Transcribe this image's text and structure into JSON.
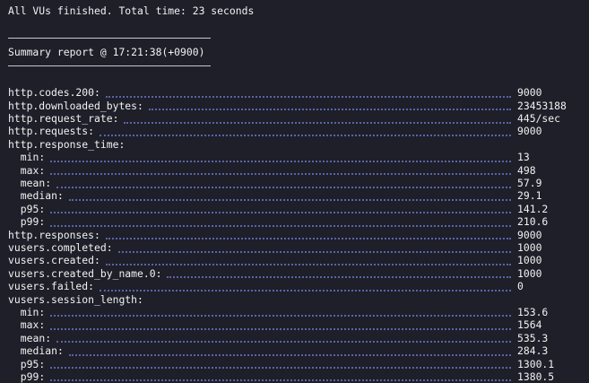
{
  "header": {
    "finished_text": "All VUs finished. Total time: 23 seconds",
    "summary_title": "Summary report @ 17:21:38(+0900)"
  },
  "metrics": [
    {
      "label": "http.codes.200:",
      "value": "9000",
      "indent": false,
      "leader": true
    },
    {
      "label": "http.downloaded_bytes:",
      "value": "23453188",
      "indent": false,
      "leader": true
    },
    {
      "label": "http.request_rate:",
      "value": "445/sec",
      "indent": false,
      "leader": true
    },
    {
      "label": "http.requests:",
      "value": "9000",
      "indent": false,
      "leader": true
    },
    {
      "label": "http.response_time:",
      "value": "",
      "indent": false,
      "leader": false
    },
    {
      "label": "min:",
      "value": "13",
      "indent": true,
      "leader": true
    },
    {
      "label": "max:",
      "value": "498",
      "indent": true,
      "leader": true
    },
    {
      "label": "mean:",
      "value": "57.9",
      "indent": true,
      "leader": true
    },
    {
      "label": "median:",
      "value": "29.1",
      "indent": true,
      "leader": true
    },
    {
      "label": "p95:",
      "value": "141.2",
      "indent": true,
      "leader": true
    },
    {
      "label": "p99:",
      "value": "210.6",
      "indent": true,
      "leader": true
    },
    {
      "label": "http.responses:",
      "value": "9000",
      "indent": false,
      "leader": true
    },
    {
      "label": "vusers.completed:",
      "value": "1000",
      "indent": false,
      "leader": true
    },
    {
      "label": "vusers.created:",
      "value": "1000",
      "indent": false,
      "leader": true
    },
    {
      "label": "vusers.created_by_name.0:",
      "value": "1000",
      "indent": false,
      "leader": true
    },
    {
      "label": "vusers.failed:",
      "value": "0",
      "indent": false,
      "leader": true
    },
    {
      "label": "vusers.session_length:",
      "value": "",
      "indent": false,
      "leader": false
    },
    {
      "label": "min:",
      "value": "153.6",
      "indent": true,
      "leader": true
    },
    {
      "label": "max:",
      "value": "1564",
      "indent": true,
      "leader": true
    },
    {
      "label": "mean:",
      "value": "535.3",
      "indent": true,
      "leader": true
    },
    {
      "label": "median:",
      "value": "284.3",
      "indent": true,
      "leader": true
    },
    {
      "label": "p95:",
      "value": "1300.1",
      "indent": true,
      "leader": true
    },
    {
      "label": "p99:",
      "value": "1380.5",
      "indent": true,
      "leader": true
    }
  ],
  "colors": {
    "background": "#1e1f29",
    "text": "#f2f2f2",
    "leader_dots": "#5965a6",
    "rule": "#c9c9c9"
  }
}
